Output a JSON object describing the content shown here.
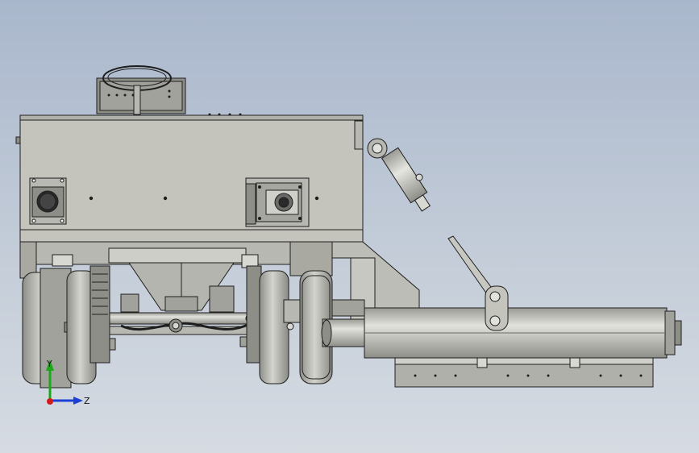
{
  "viewport": {
    "background_top": "#a9b7cc",
    "background_bottom": "#d6dbe2"
  },
  "model": {
    "body_color": "#c4c4bc",
    "edge_color": "#1e1e1e",
    "shade_color": "#a9a9a2",
    "tire_color": "#bdbdb6"
  },
  "triad": {
    "y_label": "Y",
    "z_label": "Z",
    "y_color": "#1aa81a",
    "z_color": "#1c3fd6",
    "origin_color": "#d21a1a"
  }
}
